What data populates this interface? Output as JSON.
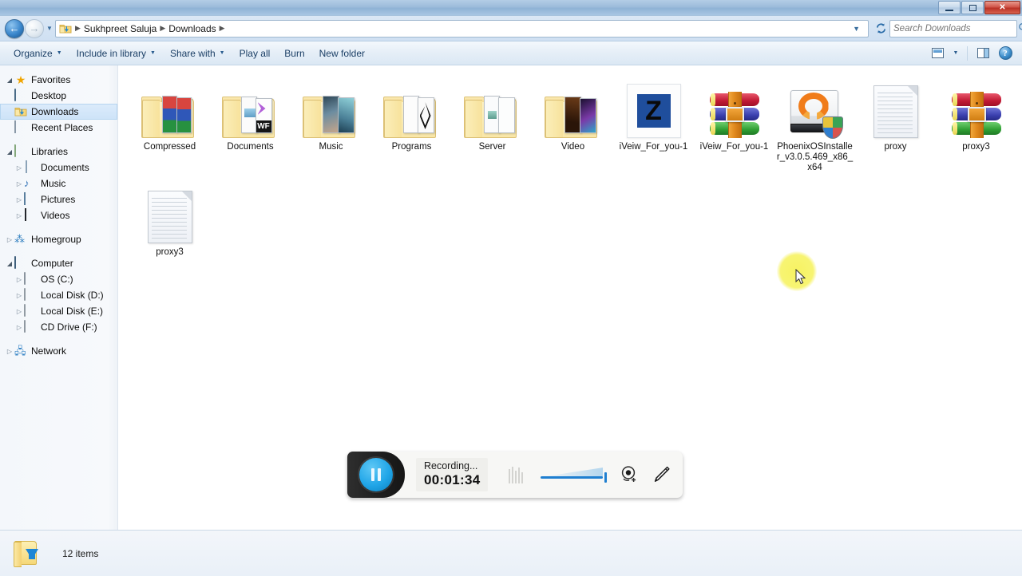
{
  "window": {
    "minimize_label": "Minimize",
    "maximize_label": "Maximize",
    "close_label": "Close"
  },
  "address_bar": {
    "back_label": "Back",
    "forward_label": "Forward",
    "history_label": "Recent pages",
    "folder_icon": "downloads-folder-icon",
    "breadcrumbs": [
      "Sukhpreet Saluja",
      "Downloads"
    ],
    "dropdown_label": "Previous locations",
    "refresh_label": "Refresh",
    "search_placeholder": "Search Downloads",
    "search_value": ""
  },
  "command_bar": {
    "items": [
      {
        "label": "Organize",
        "has_caret": true
      },
      {
        "label": "Include in library",
        "has_caret": true
      },
      {
        "label": "Share with",
        "has_caret": true
      },
      {
        "label": "Play all",
        "has_caret": false
      },
      {
        "label": "Burn",
        "has_caret": false
      },
      {
        "label": "New folder",
        "has_caret": false
      }
    ],
    "change_view_label": "Change your view",
    "view_caret_label": "More view options",
    "preview_pane_label": "Show the preview pane",
    "help_label": "?"
  },
  "nav_pane": {
    "groups": [
      {
        "header": {
          "label": "Favorites",
          "icon": "star-icon",
          "twisty": "open"
        },
        "items": [
          {
            "label": "Desktop",
            "icon": "desktop-icon",
            "selected": false
          },
          {
            "label": "Downloads",
            "icon": "downloads-folder-icon",
            "selected": true
          },
          {
            "label": "Recent Places",
            "icon": "recent-places-icon",
            "selected": false
          }
        ]
      },
      {
        "header": {
          "label": "Libraries",
          "icon": "library-icon",
          "twisty": "open"
        },
        "items": [
          {
            "label": "Documents",
            "icon": "documents-icon",
            "twisty": "closed"
          },
          {
            "label": "Music",
            "icon": "music-note-icon",
            "twisty": "closed"
          },
          {
            "label": "Pictures",
            "icon": "pictures-icon",
            "twisty": "closed"
          },
          {
            "label": "Videos",
            "icon": "videos-icon",
            "twisty": "closed"
          }
        ]
      },
      {
        "header": {
          "label": "Homegroup",
          "icon": "homegroup-icon",
          "twisty": "closed"
        },
        "items": []
      },
      {
        "header": {
          "label": "Computer",
          "icon": "computer-icon",
          "twisty": "open"
        },
        "items": [
          {
            "label": "OS (C:)",
            "icon": "os-drive-icon",
            "twisty": "closed"
          },
          {
            "label": "Local Disk (D:)",
            "icon": "hard-drive-icon",
            "twisty": "closed"
          },
          {
            "label": "Local Disk (E:)",
            "icon": "hard-drive-icon",
            "twisty": "closed"
          },
          {
            "label": "CD Drive (F:)",
            "icon": "cd-drive-icon",
            "twisty": "closed"
          }
        ]
      },
      {
        "header": {
          "label": "Network",
          "icon": "network-icon",
          "twisty": "closed"
        },
        "items": []
      }
    ]
  },
  "files": [
    {
      "name": "Compressed",
      "type": "folder",
      "thumb": "compressed-thumbnail"
    },
    {
      "name": "Documents",
      "type": "folder",
      "thumb": "documents-thumbnail"
    },
    {
      "name": "Music",
      "type": "folder",
      "thumb": "music-thumbnail"
    },
    {
      "name": "Programs",
      "type": "folder",
      "thumb": "programs-thumbnail"
    },
    {
      "name": "Server",
      "type": "folder",
      "thumb": "server-thumbnail"
    },
    {
      "name": "Video",
      "type": "folder",
      "thumb": "video-thumbnail"
    },
    {
      "name": "iVeiw_For_you-1",
      "type": "zsoft",
      "thumb": "z-app-icon"
    },
    {
      "name": "iVeiw_For_you-1",
      "type": "archive",
      "thumb": "winrar-archive-icon"
    },
    {
      "name": "PhoenixOSInstaller_v3.0.5.469_x86_x64",
      "type": "installer",
      "thumb": "phoenix-os-installer-icon"
    },
    {
      "name": "proxy",
      "type": "document",
      "thumb": "text-document-icon"
    },
    {
      "name": "proxy3",
      "type": "archive",
      "thumb": "winrar-archive-icon"
    },
    {
      "name": "proxy3",
      "type": "document",
      "thumb": "text-document-icon"
    }
  ],
  "status_bar": {
    "icon": "downloads-folder-icon",
    "text": "12 items"
  },
  "recorder": {
    "pause_label": "Pause recording",
    "status": "Recording...",
    "time": "00:01:34",
    "meter_label": "Audio level",
    "slider_label": "Volume",
    "webcam_label": "Add webcam",
    "draw_label": "Draw / annotate"
  },
  "colors": {
    "accent": "#1f7fd0",
    "titlebar": "#9dbcdb",
    "selection": "#cde3f8",
    "close_button": "#b93226",
    "cursor_highlight": "#f6f25a"
  }
}
